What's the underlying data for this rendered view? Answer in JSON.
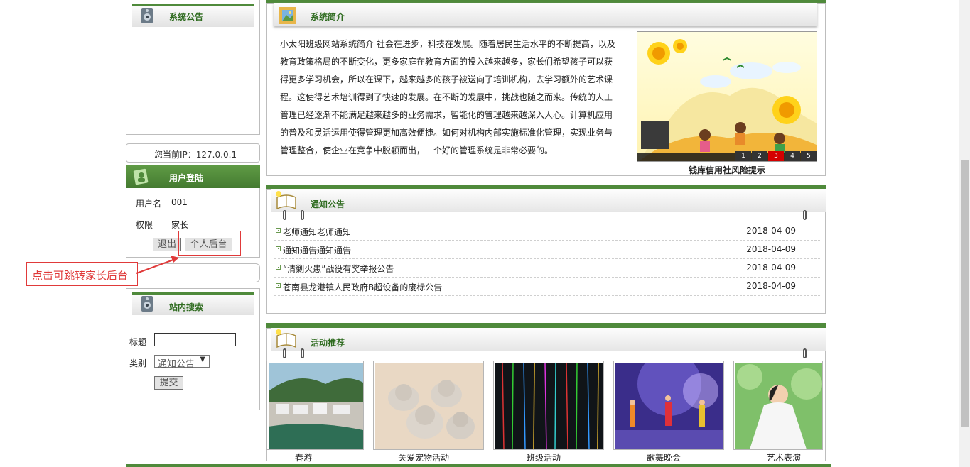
{
  "sidebar": {
    "announcement": {
      "title": "系统公告"
    },
    "ip_text": "您当前IP：127.0.0.1",
    "login": {
      "title": "用户登陆",
      "username_label": "用户名",
      "username_value": "001",
      "role_label": "权限",
      "role_value": "家长",
      "logout_button": "退出",
      "backend_button": "个人后台"
    },
    "search": {
      "title": "站内搜索",
      "title_label": "标题",
      "title_value": "",
      "category_label": "类别",
      "category_value": "通知公告",
      "submit_button": "提交"
    }
  },
  "annotation": {
    "text": "点击可跳转家长后台",
    "color": "#e03a3a"
  },
  "intro": {
    "title": "系统简介",
    "lines": [
      "小太阳班级网站系统简介 社会在进步，科技在发展。随着居民生活水平的不断提高，以及",
      "教育政策格局的不断变化，更多家庭在教育方面的投入越来越多，家长们希望孩子可以获",
      "得更多学习机会，所以在课下，越来越多的孩子被送向了培训机构，去学习额外的艺术课",
      "程。这使得艺术培训得到了快速的发展。在不断的发展中，挑战也随之而来。传统的人工",
      "管理已经逐渐不能满足越来越多的业务需求，智能化的管理越来越深入人心。计算机应用",
      "的普及和灵活运用使得管理更加高效便捷。如何对机构内部实施标准化管理，实现业务与",
      "管理整合，使企业在竞争中脱颖而出，一个好的管理系统是非常必要的。"
    ],
    "slideshow": {
      "caption": "钱库信用社风险提示",
      "pages": [
        "1",
        "2",
        "3",
        "4",
        "5"
      ],
      "active_page": "3"
    }
  },
  "notices": {
    "title": "通知公告",
    "items": [
      {
        "title": "老师通知老师通知",
        "date": "2018-04-09"
      },
      {
        "title": "通知通告通知通告",
        "date": "2018-04-09"
      },
      {
        "title": "“清剿火患”战役有奖举报公告",
        "date": "2018-04-09"
      },
      {
        "title": "苍南县龙港镇人民政府B超设备的废标公告",
        "date": "2018-04-09"
      }
    ]
  },
  "activities": {
    "title": "活动推荐",
    "items": [
      {
        "caption": "春游"
      },
      {
        "caption": "关爱宠物活动"
      },
      {
        "caption": "班级活动"
      },
      {
        "caption": "歌舞晚会"
      },
      {
        "caption": "艺术表演"
      }
    ]
  },
  "colors": {
    "brand_green": "#4f8a3b",
    "header_text": "#2e6b1f"
  }
}
